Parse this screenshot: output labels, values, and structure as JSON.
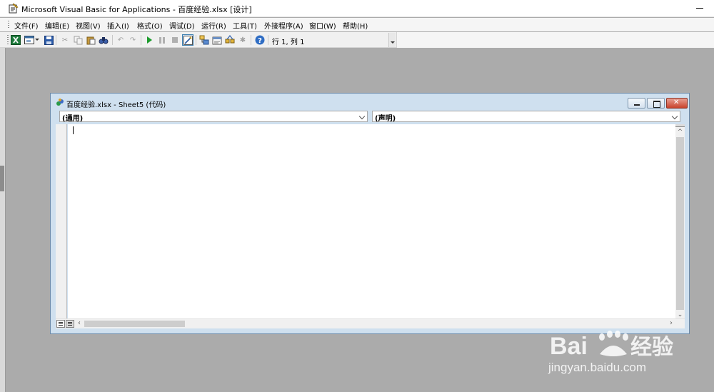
{
  "window": {
    "title": "Microsoft Visual Basic for Applications - 百度经验.xlsx [设计]"
  },
  "menu": {
    "items": [
      {
        "label": "文件(F)"
      },
      {
        "label": "编辑(E)"
      },
      {
        "label": "视图(V)"
      },
      {
        "label": "插入(I)"
      },
      {
        "label": "格式(O)"
      },
      {
        "label": "调试(D)"
      },
      {
        "label": "运行(R)"
      },
      {
        "label": "工具(T)"
      },
      {
        "label": "外接程序(A)"
      },
      {
        "label": "窗口(W)"
      },
      {
        "label": "帮助(H)"
      }
    ]
  },
  "toolbar": {
    "cursor_position": "行 1, 列 1",
    "icons": [
      "excel-view-icon",
      "insert-userform-icon",
      "save-icon",
      "cut-icon",
      "copy-icon",
      "paste-icon",
      "find-icon",
      "undo-icon",
      "redo-icon",
      "run-icon",
      "break-icon",
      "reset-icon",
      "design-mode-icon",
      "project-explorer-icon",
      "properties-icon",
      "object-browser-icon",
      "toolbox-icon",
      "help-icon"
    ]
  },
  "code_window": {
    "title": "百度经验.xlsx - Sheet5 (代码)",
    "object_combo": "(通用)",
    "procedure_combo": "(声明)"
  },
  "watermark": {
    "logo_text": "Bai 经验",
    "url": "jingyan.baidu.com"
  },
  "colors": {
    "workspace": "#ababab",
    "code_window_frame": "#cfe0ef",
    "close_button": "#c9432c"
  }
}
